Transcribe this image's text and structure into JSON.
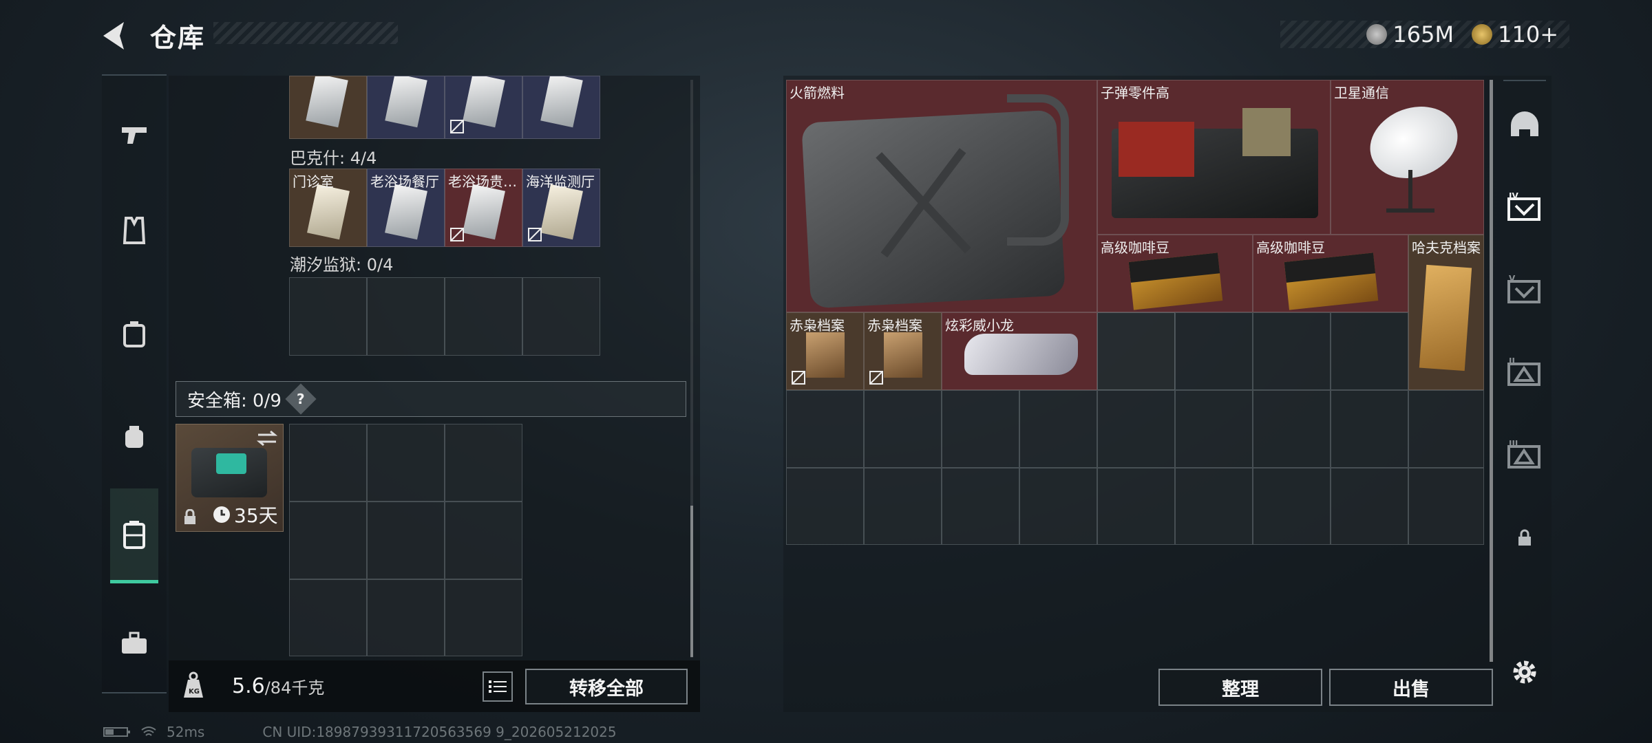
{
  "header": {
    "title": "仓库",
    "currencies": [
      {
        "icon": "silver-coin-icon",
        "value": "165M"
      },
      {
        "icon": "gold-triangle-coin-icon",
        "value": "110+"
      }
    ]
  },
  "left_nav": {
    "items": [
      {
        "name": "weapon",
        "icon": "pistol-icon"
      },
      {
        "name": "armor",
        "icon": "vest-icon"
      },
      {
        "name": "backpack",
        "icon": "backpack-icon"
      },
      {
        "name": "chest-rig",
        "icon": "rig-icon"
      },
      {
        "name": "container",
        "icon": "case-icon",
        "active": true
      },
      {
        "name": "toolbox",
        "icon": "toolbox-icon"
      }
    ]
  },
  "left_panel": {
    "sections": [
      {
        "label": "",
        "cells": [
          {
            "label": "",
            "tone": "brown"
          },
          {
            "label": "",
            "tone": "blue"
          },
          {
            "label": "",
            "tone": "blue",
            "found": true
          },
          {
            "label": "",
            "tone": "blue"
          }
        ]
      },
      {
        "label": "巴克什: 4/4",
        "cells": [
          {
            "label": "门诊室",
            "tone": "brown"
          },
          {
            "label": "老浴场餐厅",
            "tone": "blue"
          },
          {
            "label": "老浴场贵…",
            "tone": "red",
            "found": true
          },
          {
            "label": "海洋监测厅",
            "tone": "blue",
            "found": true
          }
        ]
      },
      {
        "label": "潮汐监狱: 0/4",
        "cells": []
      }
    ],
    "safe_box": {
      "label": "安全箱: 0/9",
      "help": "?",
      "duration": "35天"
    },
    "footer": {
      "weight_current": "5.6",
      "weight_max": "/84千克",
      "transfer_all": "转移全部"
    }
  },
  "right_panel": {
    "items": [
      {
        "label": "火箭燃料",
        "image": "fuel-canister"
      },
      {
        "label": "子弹零件高",
        "image": "ammo-parts-box"
      },
      {
        "label": "卫星通信",
        "image": "satellite-dish"
      },
      {
        "label": "高级咖啡豆",
        "image": "coffee-bag"
      },
      {
        "label": "高级咖啡豆",
        "image": "coffee-bag"
      },
      {
        "label": "哈夫克档案",
        "image": "folder"
      },
      {
        "label": "赤枭档案",
        "image": "document-pouch",
        "found": true
      },
      {
        "label": "赤枭档案",
        "image": "document-pouch",
        "found": true
      },
      {
        "label": "炫彩威小龙",
        "image": "dragon-figure"
      }
    ],
    "buttons": {
      "sort": "整理",
      "sell": "出售"
    }
  },
  "right_nav": {
    "items": [
      {
        "icon": "helmet-icon"
      },
      {
        "icon": "level-iv-storage-icon",
        "active": true
      },
      {
        "icon": "level-v-storage-icon"
      },
      {
        "icon": "level-ii-storage-icon"
      },
      {
        "icon": "level-iii-storage-icon"
      },
      {
        "icon": "lock-icon"
      }
    ]
  },
  "status": {
    "ping": "52ms",
    "uid": "CN UID:18987939311720563569 9_202605212025"
  },
  "colors": {
    "accent": "#3fcaa0",
    "red_tile": "#5a2a2e",
    "blue_tile": "#2f3450",
    "brown_tile": "#4a3a2c"
  }
}
